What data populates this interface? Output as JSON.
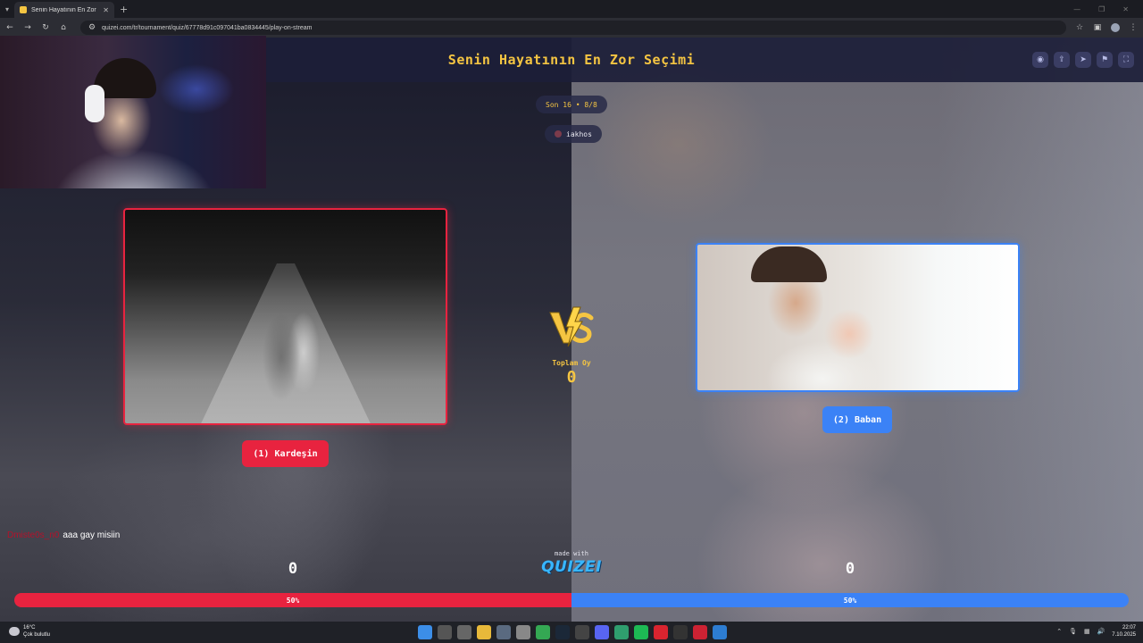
{
  "browser": {
    "tab_title": "Senin Hayatının En Zor Seçimi",
    "tab_close": "✕",
    "new_tab": "+",
    "url": "quizei.com/tr/tournament/quiz/67778d91c097041ba0834445/play-on-stream"
  },
  "header": {
    "title": "Senin Hayatının En Zor Seçimi",
    "icons": [
      "eye-icon",
      "share-icon",
      "send-icon",
      "flag-icon",
      "fullscreen-icon"
    ]
  },
  "round": "Son 16 • 8/8",
  "streamer": "iakhos",
  "left": {
    "label": "(1) Kardeşin",
    "score": "0",
    "percent_label": "50%",
    "percent": 50,
    "color": "#e8233f"
  },
  "right": {
    "label": "(2) Baban",
    "score": "0",
    "percent_label": "50%",
    "percent": 50,
    "color": "#3b82f6"
  },
  "total": {
    "label": "Toplam Oy",
    "value": "0"
  },
  "chat": {
    "user": "Dmiste0s_n0",
    "message": "aaa gay misiin"
  },
  "branding": {
    "made_with": "made with",
    "logo": "QUIZEI"
  },
  "taskbar": {
    "temperature": "16°C",
    "weather": "Çok bulutlu",
    "time": "22:07",
    "date": "7.10.2025"
  },
  "colors": {
    "accent": "#f5c542",
    "left": "#e8233f",
    "right": "#3b82f6"
  }
}
